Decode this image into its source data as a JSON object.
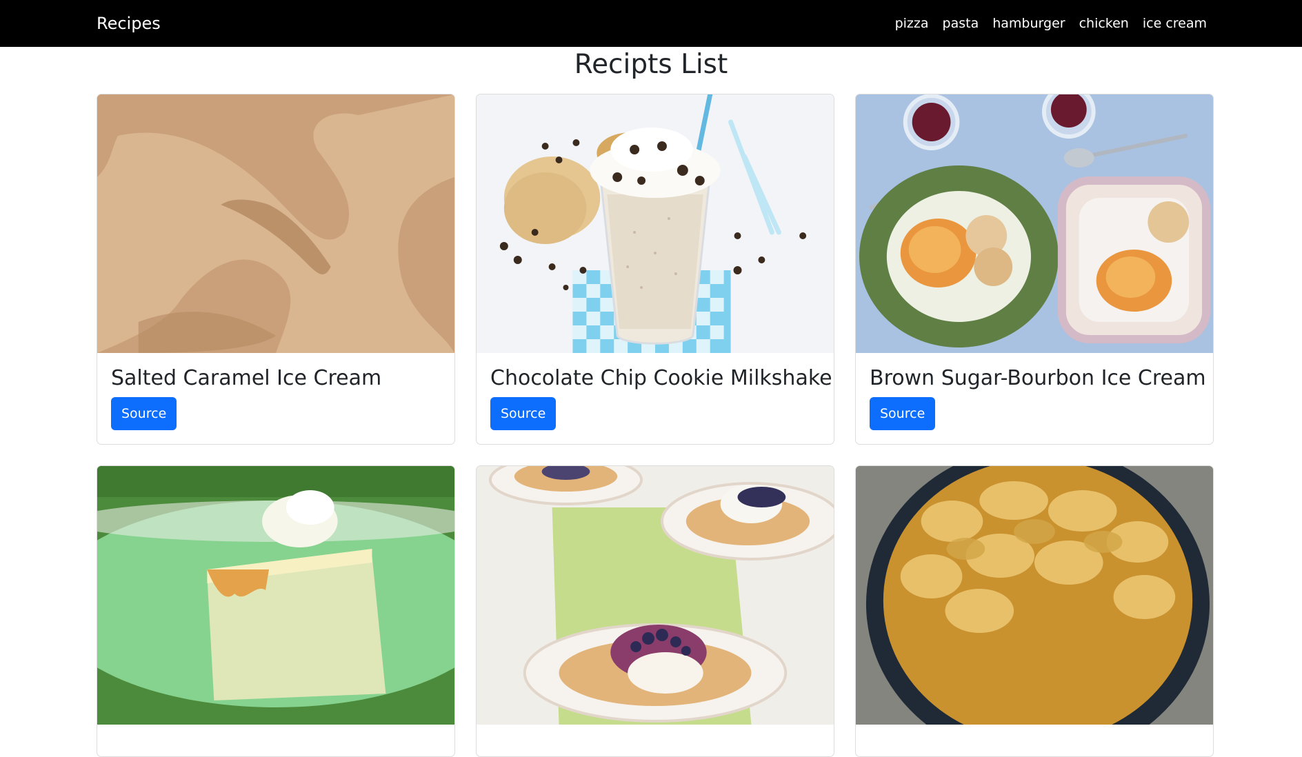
{
  "navbar": {
    "brand": "Recipes",
    "links": [
      "pizza",
      "pasta",
      "hamburger",
      "chicken",
      "ice cream"
    ]
  },
  "page_title": "Recipts List",
  "cards": [
    {
      "title": "Salted Caramel Ice Cream",
      "button": "Source"
    },
    {
      "title": "Chocolate Chip Cookie Milkshake",
      "button": "Source"
    },
    {
      "title": "Brown Sugar-Bourbon Ice Cream",
      "button": "Source"
    },
    {
      "title": "",
      "button": ""
    },
    {
      "title": "",
      "button": ""
    },
    {
      "title": "",
      "button": ""
    }
  ],
  "colors": {
    "navbar_bg": "#000000",
    "button_bg": "#0d6efd"
  }
}
